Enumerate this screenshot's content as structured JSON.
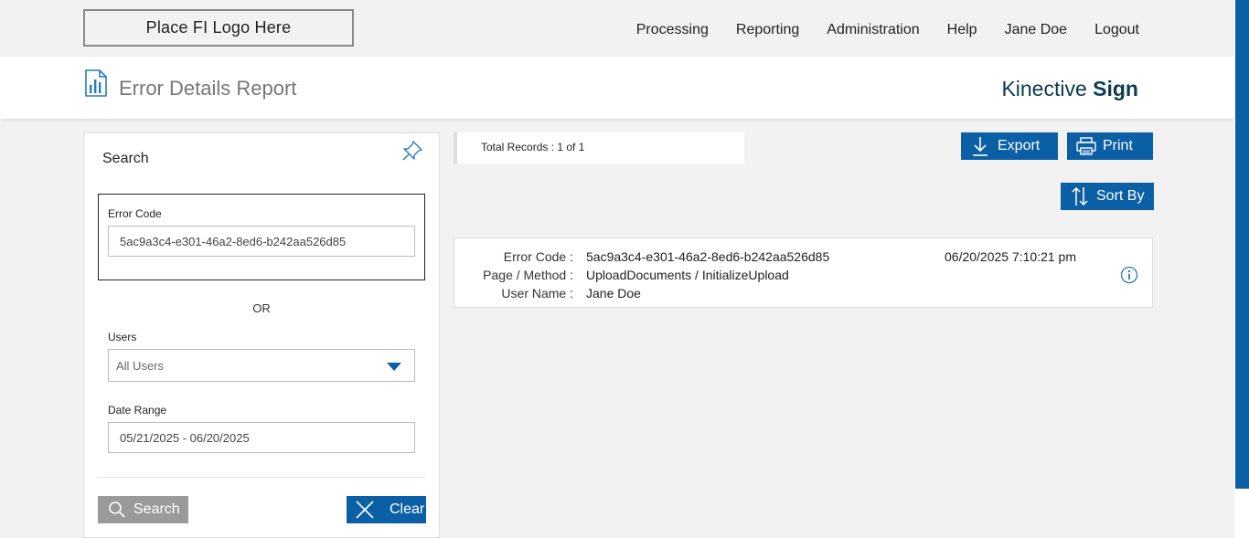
{
  "header": {
    "logo_text": "Place FI Logo Here",
    "nav": [
      "Processing",
      "Reporting",
      "Administration",
      "Help",
      "Jane Doe",
      "Logout"
    ]
  },
  "titlebar": {
    "title": "Error Details Report",
    "brand_light": "Kinective ",
    "brand_bold": "Sign"
  },
  "search_panel": {
    "title": "Search",
    "error_code_label": "Error Code",
    "error_code_value": "5ac9a3c4-e301-46a2-8ed6-b242aa526d85",
    "or_text": "OR",
    "users_label": "Users",
    "users_value": "All Users",
    "date_range_label": "Date Range",
    "date_range_value": "05/21/2025 - 06/20/2025",
    "search_button": "Search",
    "clear_button": "Clear"
  },
  "results": {
    "total_records": "Total Records : 1 of 1",
    "export_button": "Export",
    "print_button": "Print",
    "sort_button": "Sort By",
    "record": {
      "error_code_label": "Error Code :",
      "error_code": "5ac9a3c4-e301-46a2-8ed6-b242aa526d85",
      "page_method_label": "Page / Method :",
      "page_method": "UploadDocuments / InitializeUpload",
      "user_name_label": "User Name :",
      "user_name": "Jane Doe",
      "timestamp": "06/20/2025 7:10:21 pm"
    }
  },
  "colors": {
    "accent": "#0b5fa5",
    "brand": "#0d3b4c",
    "disabled_button": "#9a9a9a"
  }
}
